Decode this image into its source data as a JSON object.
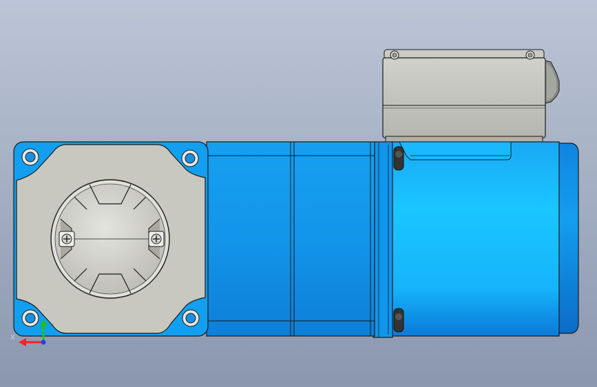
{
  "viewport": {
    "background_top": "#bcc5d6",
    "background_bottom": "#8a97ae"
  },
  "colors": {
    "motor_blue_light": "#19c3ff",
    "motor_blue_mid": "#0f9ef0",
    "motor_blue_dark": "#0a6fd0",
    "flange_gray": "#c9c9c1",
    "terminal_box_gray": "#bdbfb8",
    "outline": "#1a1a1a"
  },
  "triad": {
    "x_label": "X",
    "x_color": "#ff2020",
    "y_color": "#20c020",
    "origin_color": "#2040ff"
  }
}
